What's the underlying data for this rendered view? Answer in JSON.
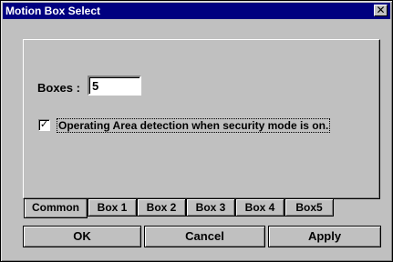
{
  "window": {
    "title": "Motion Box Select",
    "close_symbol": "✕"
  },
  "fields": {
    "boxes_label": "Boxes :",
    "boxes_value": "5",
    "security_checkbox": {
      "checked": true,
      "check_mark": "✓",
      "label": "Operating Area detection when security mode is on."
    }
  },
  "tabs": [
    {
      "label": "Common",
      "active": true
    },
    {
      "label": "Box 1",
      "active": false
    },
    {
      "label": "Box 2",
      "active": false
    },
    {
      "label": "Box 3",
      "active": false
    },
    {
      "label": "Box 4",
      "active": false
    },
    {
      "label": "Box5",
      "active": false
    }
  ],
  "buttons": {
    "ok": "OK",
    "cancel": "Cancel",
    "apply": "Apply"
  }
}
